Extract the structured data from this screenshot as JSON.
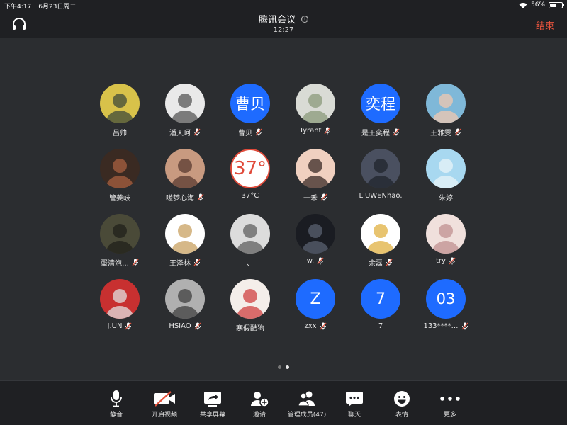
{
  "status_bar": {
    "time": "下午4:17",
    "date": "6月23日周二",
    "battery": "56%",
    "battery_level": 0.56
  },
  "header": {
    "title": "腾讯会议",
    "duration": "12:27",
    "end_label": "结束",
    "info_icon": "ⓘ"
  },
  "members": [
    {
      "name": "吕帅",
      "avatar": "photo",
      "muted": false,
      "colors": [
        "#d8c24a",
        "#3f4a3a"
      ]
    },
    {
      "name": "潘天珂",
      "avatar": "photo",
      "muted": true,
      "colors": [
        "#e9e9e9",
        "#555"
      ]
    },
    {
      "name": "曹贝",
      "avatar": "text",
      "avatar_text": "曹贝",
      "muted": true
    },
    {
      "name": "Tyrant",
      "avatar": "photo",
      "muted": true,
      "colors": [
        "#d9dbd5",
        "#8a9a7a"
      ]
    },
    {
      "name": "是王奕程",
      "avatar": "text",
      "avatar_text": "奕程",
      "muted": true
    },
    {
      "name": "王雅雯",
      "avatar": "photo",
      "muted": true,
      "colors": [
        "#7fb8d8",
        "#f0c8b0"
      ]
    },
    {
      "name": "管姜岐",
      "avatar": "photo",
      "muted": false,
      "colors": [
        "#3a2a22",
        "#a86040"
      ]
    },
    {
      "name": "嗟梦心海",
      "avatar": "photo",
      "muted": true,
      "colors": [
        "#c89a80",
        "#5a3a30"
      ]
    },
    {
      "name": "37°C",
      "avatar": "badge",
      "avatar_text": "37°",
      "muted": false
    },
    {
      "name": "一禾",
      "avatar": "photo",
      "muted": true,
      "colors": [
        "#f0d0c0",
        "#3a2a25"
      ]
    },
    {
      "name": "LIUWENhao.",
      "avatar": "photo",
      "muted": false,
      "colors": [
        "#4a5060",
        "#20242c"
      ]
    },
    {
      "name": "朱婷",
      "avatar": "photo",
      "muted": false,
      "colors": [
        "#a8d8f0",
        "#e8f4f8"
      ]
    },
    {
      "name": "蛋清泡…",
      "avatar": "photo",
      "muted": true,
      "colors": [
        "#4a4a38",
        "#20201a"
      ]
    },
    {
      "name": "王泽林",
      "avatar": "photo",
      "muted": true,
      "colors": [
        "#ffffff",
        "#c8a060"
      ]
    },
    {
      "name": "、",
      "avatar": "photo",
      "muted": false,
      "colors": [
        "#dcdcdc",
        "#606060"
      ]
    },
    {
      "name": "w.",
      "avatar": "photo",
      "muted": true,
      "colors": [
        "#1a1c22",
        "#5a6070"
      ]
    },
    {
      "name": "余磊",
      "avatar": "photo",
      "muted": true,
      "colors": [
        "#ffffff",
        "#e0b040"
      ]
    },
    {
      "name": "try",
      "avatar": "photo",
      "muted": true,
      "colors": [
        "#f0e0dc",
        "#c09090"
      ]
    },
    {
      "name": "J.UN",
      "avatar": "photo",
      "muted": true,
      "colors": [
        "#c83030",
        "#e0e0e0"
      ]
    },
    {
      "name": "HSIAO",
      "avatar": "photo",
      "muted": true,
      "colors": [
        "#b0b0b0",
        "#404040"
      ]
    },
    {
      "name": "寒假酷狗",
      "avatar": "photo",
      "muted": false,
      "colors": [
        "#f4eeea",
        "#d04040"
      ]
    },
    {
      "name": "zxx",
      "avatar": "text",
      "avatar_text": "Z",
      "muted": true
    },
    {
      "name": "7",
      "avatar": "text",
      "avatar_text": "7",
      "muted": false
    },
    {
      "name": "133****…",
      "avatar": "text",
      "avatar_text": "03",
      "muted": true
    }
  ],
  "pagination": {
    "pages": 2,
    "current": 2
  },
  "toolbar": {
    "mute_label": "静音",
    "video_label": "开启视频",
    "share_label": "共享屏幕",
    "invite_label": "邀请",
    "manage_label": "管理成员(47)",
    "chat_label": "聊天",
    "emoji_label": "表情",
    "more_label": "更多"
  },
  "colors": {
    "background": "#2b2d30",
    "bar": "#1f2023",
    "accent_blue": "#1e6bff",
    "end_red": "#e5533d"
  }
}
